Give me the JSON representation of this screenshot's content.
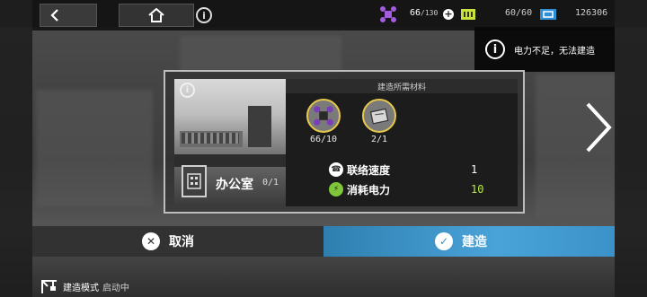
{
  "topbar": {
    "resources": {
      "drone_value": "66",
      "drone_max": "/130",
      "battery_value": "60/60",
      "coin_value": "126306"
    },
    "icons": {
      "back": "chevron-left-icon",
      "home": "home-icon",
      "info": "info-icon",
      "drone": "drone-icon",
      "plus": "plus-icon",
      "battery": "battery-icon",
      "coin": "ticket-icon"
    }
  },
  "notice": {
    "text": "电力不足，无法建造"
  },
  "dialog": {
    "requirements_title": "建造所需材料",
    "materials": [
      {
        "icon": "drone-icon",
        "count": "66/10"
      },
      {
        "icon": "document-icon",
        "count": "2/1"
      }
    ],
    "room_name": "办公室",
    "room_count": "0/1",
    "stats": [
      {
        "label": "联络速度",
        "value": "1",
        "color": "#ffffff"
      },
      {
        "label": "消耗电力",
        "value": "10",
        "color": "#b6e84a"
      }
    ]
  },
  "actions": {
    "cancel_label": "取消",
    "build_label": "建造"
  },
  "status": {
    "mode_label": "建造模式",
    "mode_state": "启动中"
  },
  "colors": {
    "build_accent": "#3a92c8",
    "power_green": "#b6e84a",
    "material_ring": "#e6c84a"
  }
}
